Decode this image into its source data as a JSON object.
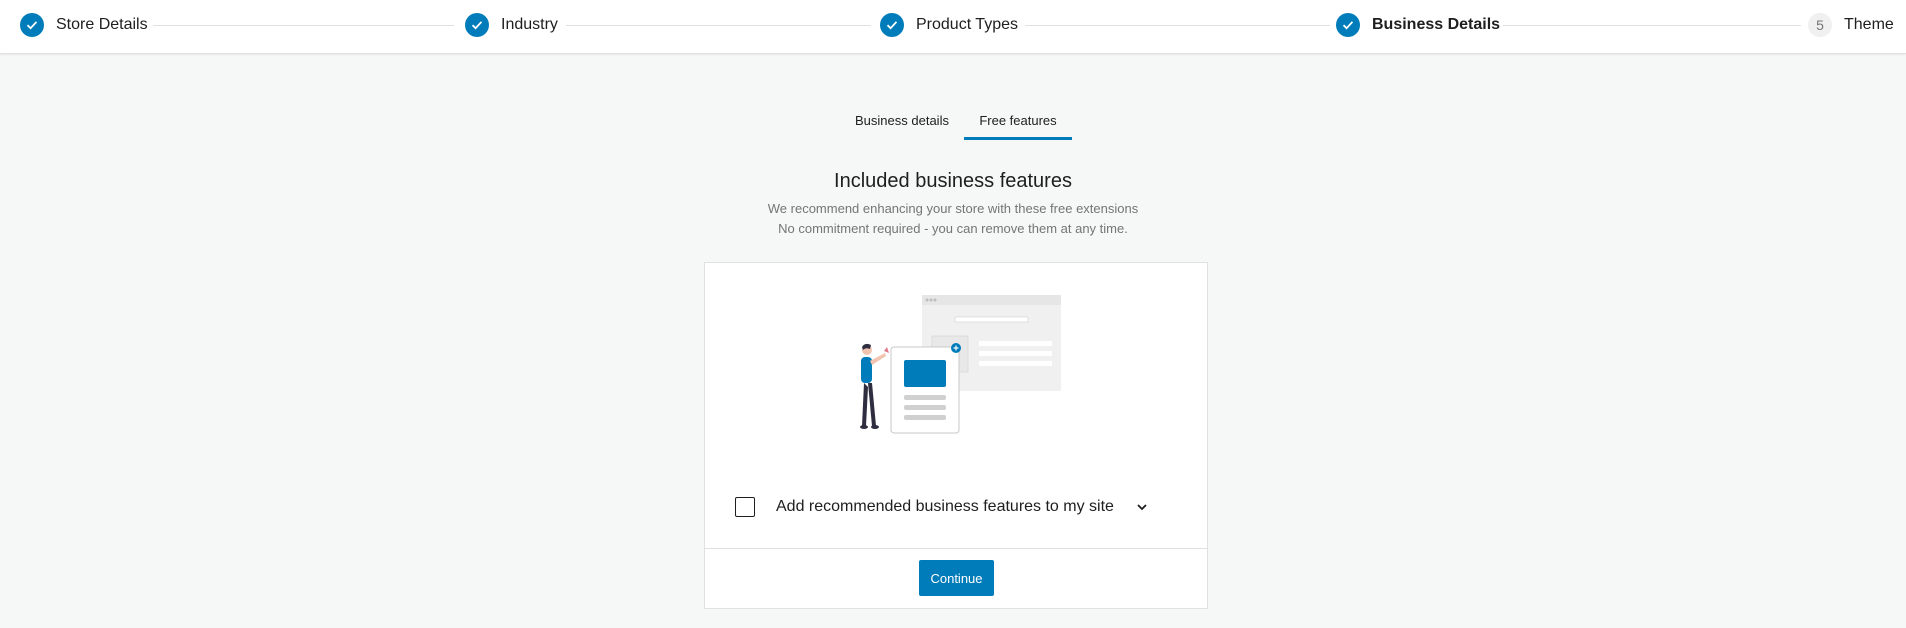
{
  "stepper": {
    "steps": [
      {
        "label": "Store Details",
        "state": "complete"
      },
      {
        "label": "Industry",
        "state": "complete"
      },
      {
        "label": "Product Types",
        "state": "complete"
      },
      {
        "label": "Business Details",
        "state": "current"
      },
      {
        "label": "Theme",
        "state": "upcoming",
        "number": "5"
      }
    ]
  },
  "tabs": [
    {
      "label": "Business details",
      "active": false
    },
    {
      "label": "Free features",
      "active": true
    }
  ],
  "main": {
    "title": "Included business features",
    "subtitle_line1": "We recommend enhancing your store with these free extensions",
    "subtitle_line2": "No commitment required - you can remove them at any time.",
    "checkbox_label": "Add recommended business features to my site",
    "checkbox_checked": false,
    "continue_label": "Continue"
  },
  "colors": {
    "accent": "#007cba",
    "background": "#f6f7f7",
    "text": "#1e1e1e",
    "muted_text": "#757575"
  },
  "icons": {
    "step_complete": "checkmark-icon",
    "expand": "chevron-down-icon"
  }
}
